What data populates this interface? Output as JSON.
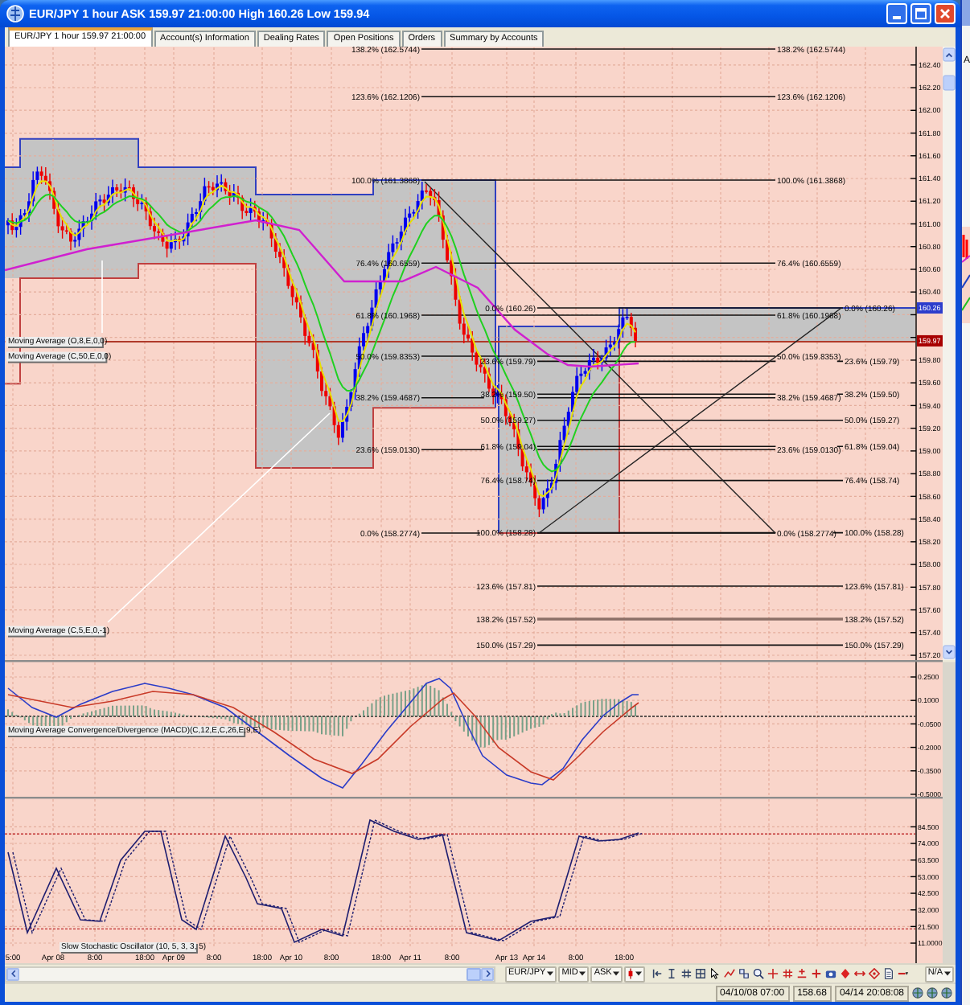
{
  "window": {
    "title": "EUR/JPY 1 hour ASK 159.97 21:00:00 High 160.26 Low 159.94"
  },
  "tabs": [
    {
      "label": "EUR/JPY 1 hour 159.97 21:00:00",
      "selected": true
    },
    {
      "label": "Account(s) Information",
      "selected": false
    },
    {
      "label": "Dealing Rates",
      "selected": false
    },
    {
      "label": "Open Positions",
      "selected": false
    },
    {
      "label": "Orders",
      "selected": false
    },
    {
      "label": "Summary by Accounts",
      "selected": false
    }
  ],
  "price_pane": {
    "indicator_labels": [
      "Moving Average (O,8,E,0,0)",
      "Moving Average (C,50,E,0,0)",
      "Moving Average (C,5,E,0,-1)"
    ],
    "fibonacci": [
      {
        "levels": [
          {
            "left": "138.2% (162.5744)",
            "right": "138.2% (162.5744)",
            "selected": false
          },
          {
            "left": "123.6% (162.1206)",
            "right": "123.6% (162.1206)",
            "selected": false
          },
          {
            "left": "100.0% (161.3868)",
            "right": "100.0% (161.3868)",
            "selected": false
          },
          {
            "left": "76.4% (160.6559)",
            "right": "76.4% (160.6559)",
            "selected": false
          },
          {
            "left": "61.8% (160.1968)",
            "right": "61.8% (160.1968)",
            "selected": false
          },
          {
            "left": "50.0% (159.8353)",
            "right": "50.0% (159.8353)",
            "selected": false
          },
          {
            "left": "38.2% (159.4687)",
            "right": "38.2% (159.4687)",
            "selected": false
          },
          {
            "left": "23.6% (159.0130)",
            "right": "23.6% (159.0130)",
            "selected": false
          },
          {
            "left": "0.0% (158.2774)",
            "right": "0.0% (158.2774)",
            "selected": false
          }
        ]
      },
      {
        "levels": [
          {
            "left": "0.0% (160.26)",
            "right": "0.0% (160.26)",
            "selected": false
          },
          {
            "left": "23.6% (159.79)",
            "right": "23.6% (159.79)",
            "selected": false
          },
          {
            "left": "38.2% (159.50)",
            "right": "38.2% (159.50)",
            "selected": false
          },
          {
            "left": "50.0% (159.27)",
            "right": "50.0% (159.27)",
            "selected": false
          },
          {
            "left": "61.8% (159.04)",
            "right": "61.8% (159.04)",
            "selected": false
          },
          {
            "left": "76.4% (158.74)",
            "right": "76.4% (158.74)",
            "selected": false
          },
          {
            "left": "100.0% (158.28)",
            "right": "100.0% (158.28)",
            "selected": false
          },
          {
            "left": "123.6% (157.81)",
            "right": "123.6% (157.81)",
            "selected": false
          },
          {
            "left": "138.2% (157.52)",
            "right": "138.2% (157.52)",
            "selected": true
          },
          {
            "left": "150.0% (157.29)",
            "right": "150.0% (157.29)",
            "selected": false
          }
        ]
      }
    ],
    "axis": [
      "162.40",
      "162.20",
      "162.00",
      "161.80",
      "161.60",
      "161.40",
      "161.20",
      "161.00",
      "160.80",
      "160.60",
      "160.40",
      "159.80",
      "159.60",
      "159.40",
      "159.20",
      "159.00",
      "158.80",
      "158.60",
      "158.40",
      "158.20",
      "158.00",
      "157.80",
      "157.60",
      "157.40",
      "157.20"
    ],
    "markers": [
      {
        "kind": "high",
        "label": "160.26"
      },
      {
        "kind": "current",
        "label": "159.97"
      }
    ]
  },
  "macd_pane": {
    "label": "Moving Average Convergence/Divergence (MACD)(C,12,E,C,26,E,9,E)",
    "axis": [
      "0.2500",
      "0.1000",
      "-0.0500",
      "-0.2000",
      "-0.3500",
      "-0.5000"
    ]
  },
  "stochastic_pane": {
    "label": "Slow Stochastic Oscillator (10, 5, 3, 3, 5)",
    "axis": [
      "84.500",
      "74.000",
      "63.500",
      "53.000",
      "42.500",
      "32.000",
      "21.500",
      "11.0000"
    ]
  },
  "time_axis": [
    "5:00",
    "Apr 08",
    "8:00",
    "18:00",
    "Apr 09",
    "8:00",
    "18:00",
    "Apr 10",
    "8:00",
    "18:00",
    "Apr 11",
    "8:00",
    "Apr 13",
    "Apr 14",
    "8:00",
    "18:00"
  ],
  "toolbar": {
    "left_dropdowns": [
      "EUR/JPY",
      "MID",
      "ASK"
    ],
    "right_dropdown": "N/A"
  },
  "status_bar": {
    "fields": [
      "04/10/08 07:00",
      "158.68",
      "04/14 20:08:08"
    ]
  },
  "background_window": {
    "text": "A"
  }
}
